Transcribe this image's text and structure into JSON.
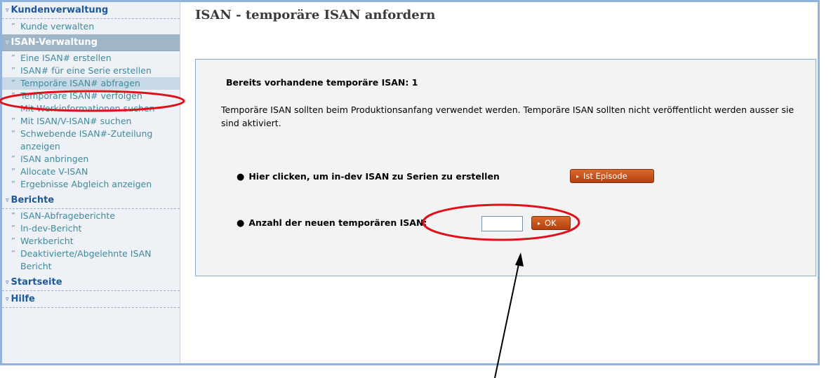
{
  "sidebar": {
    "sections": [
      {
        "label": "Kundenverwaltung",
        "items": [
          "Kunde verwalten"
        ]
      },
      {
        "label": "ISAN-Verwaltung",
        "items": [
          "Eine ISAN# erstellen",
          "ISAN# für eine Serie erstellen",
          "Temporäre ISAN# abfragen",
          "Temporäre ISAN# verfolgen",
          "Mit Werkinformationen suchen",
          "Mit ISAN/V-ISAN# suchen",
          "Schwebende ISAN#-Zuteilung anzeigen",
          "ISAN anbringen",
          "Allocate V-ISAN",
          "Ergebnisse Abgleich anzeigen"
        ]
      },
      {
        "label": "Berichte",
        "items": [
          "ISAN-Abfrageberichte",
          "In-dev-Bericht",
          "Werkbericht",
          "Deaktivierte/Abgelehnte ISAN Bericht"
        ]
      },
      {
        "label": "Startseite",
        "items": []
      },
      {
        "label": "Hilfe",
        "items": []
      }
    ],
    "item_bullet": "”",
    "section_arrow": "▿"
  },
  "main": {
    "title": "ISAN - temporäre ISAN anfordern",
    "existing_label": "Bereits vorhandene temporäre ISAN: 1",
    "info_text": "Temporäre ISAN sollten beim Produktionsanfang verwendet werden. Temporäre ISAN sollten nicht veröffentlicht werden ausser sie sind aktiviert.",
    "indev_label": "Hier clicken, um in-dev ISAN zu Serien zu erstellen",
    "episode_button": "Ist Episode",
    "count_label": "Anzahl der neuen temporären ISAN:",
    "count_value": "",
    "ok_button": "OK",
    "bullet": "●",
    "button_arrow": "▸"
  },
  "colors": {
    "frame": "#8fb3d9",
    "sidebar_bg": "#eef1f6",
    "section_text": "#1e5a9a",
    "active_section_bg": "#9fb6c8",
    "link_text": "#3f8a9e",
    "button_orange": "#c4521c",
    "annotation_red": "#e0101a"
  }
}
